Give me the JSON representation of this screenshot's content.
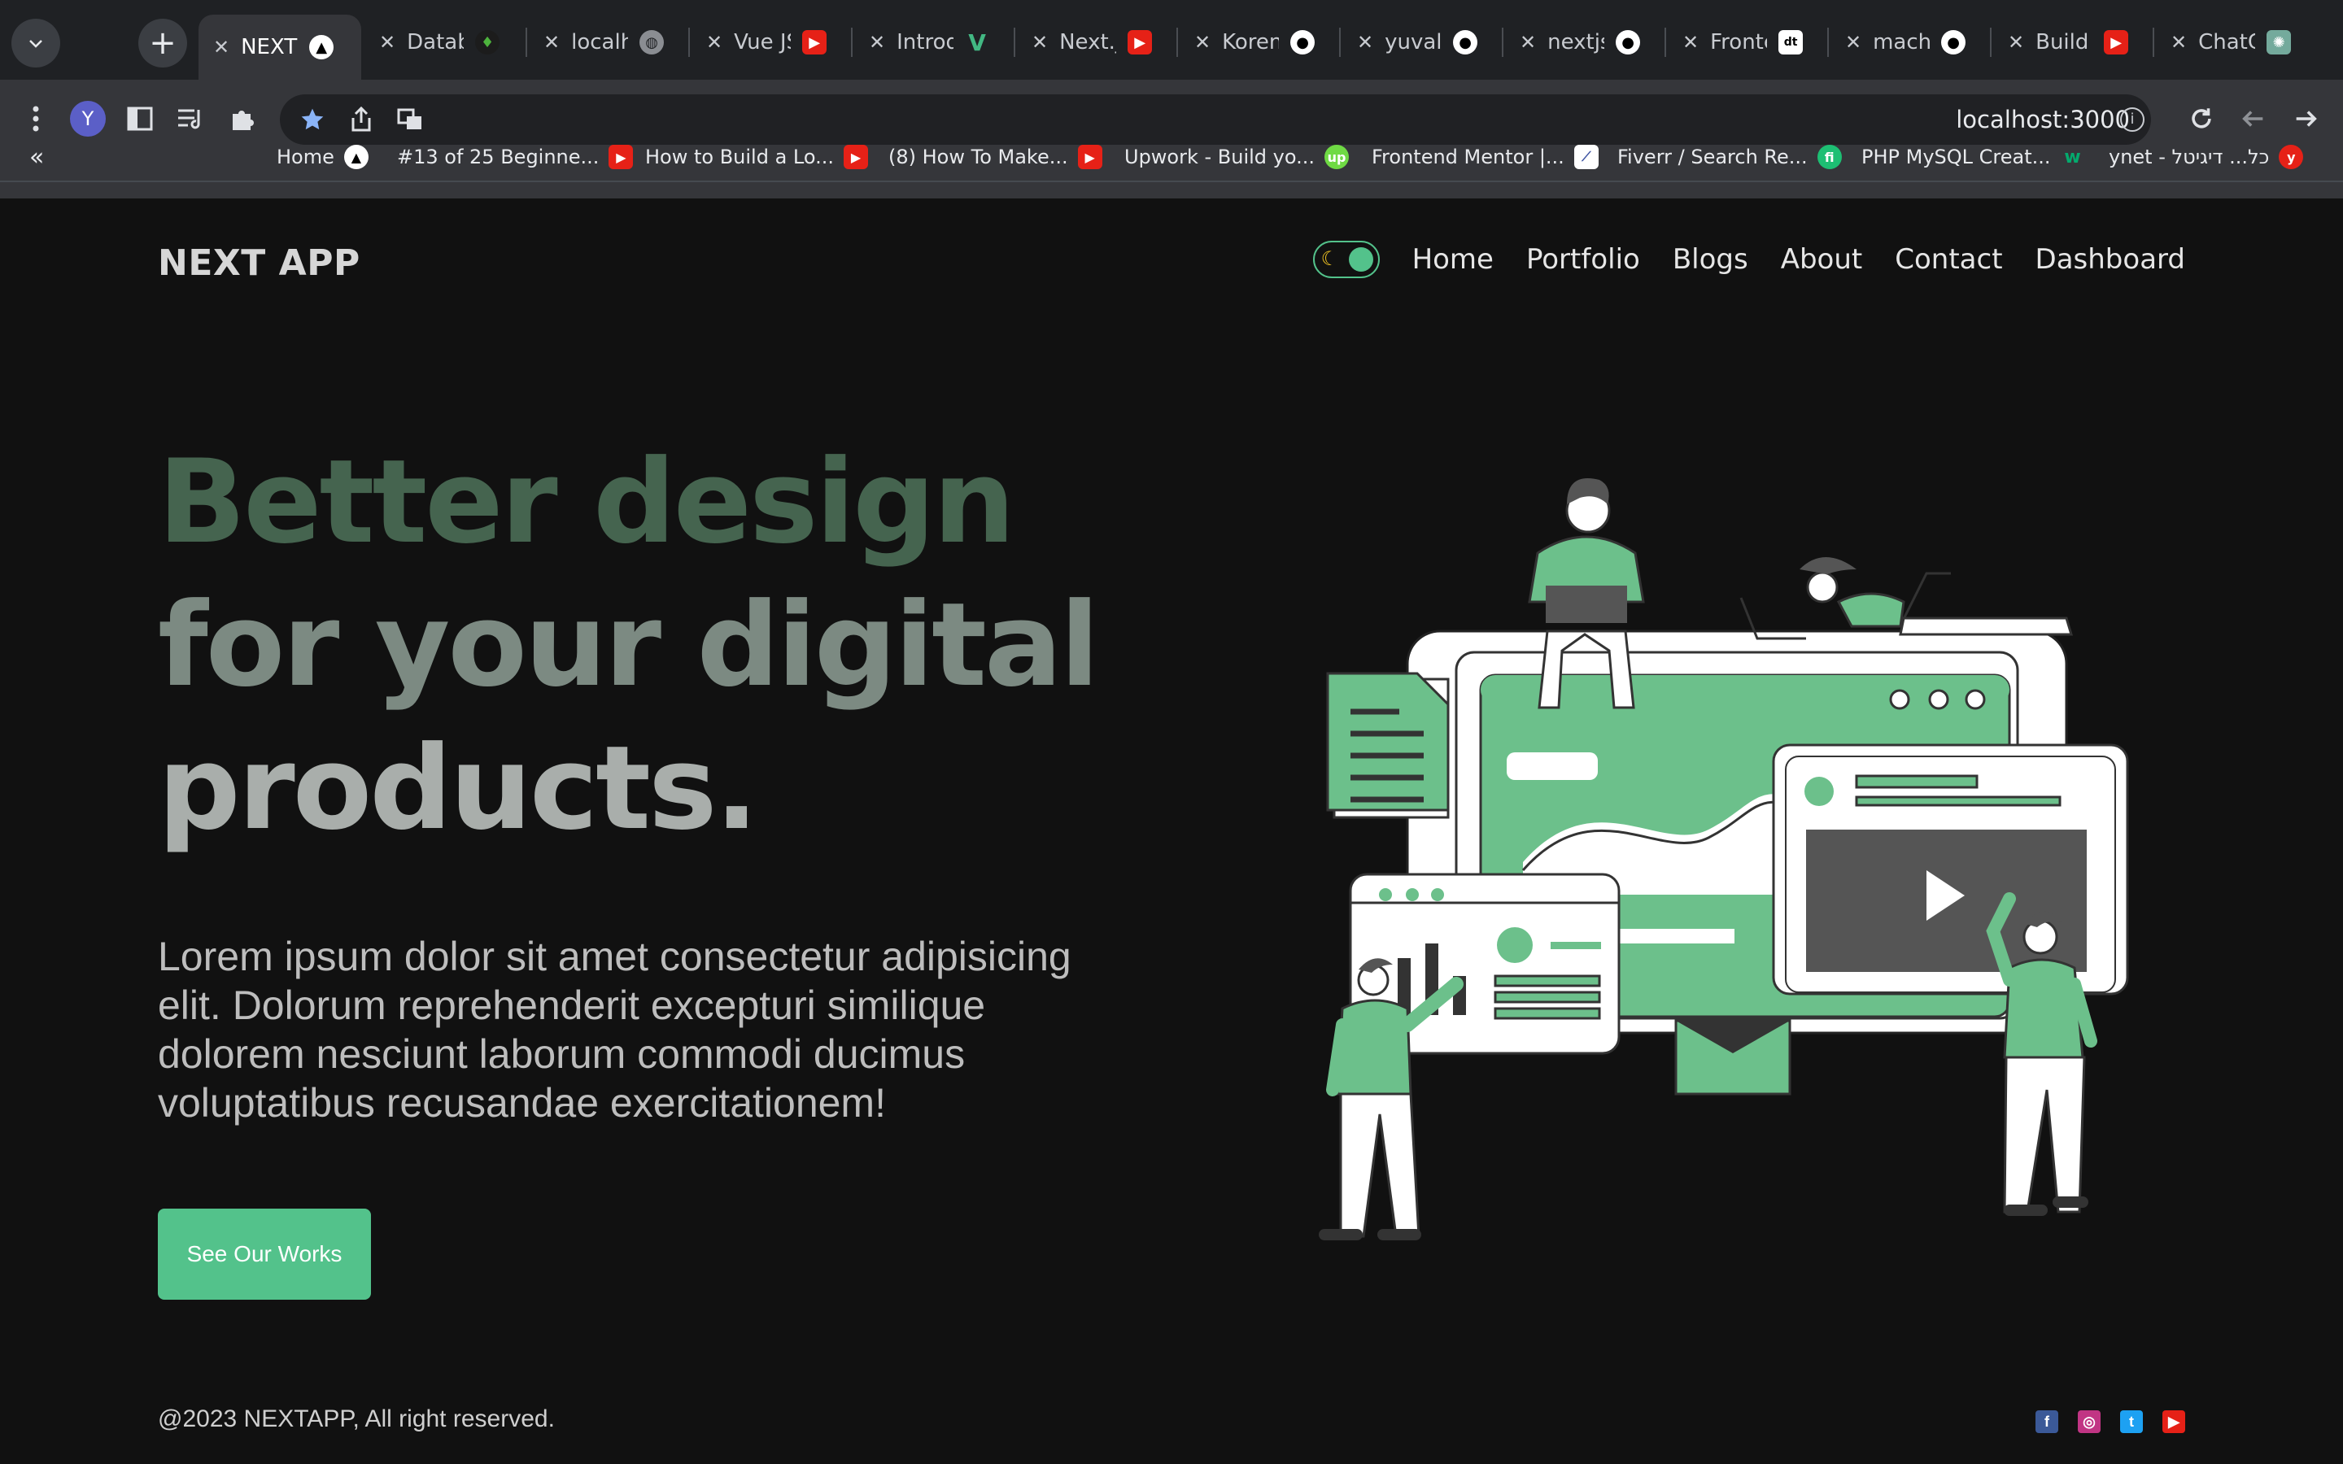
{
  "browser": {
    "tabs": [
      {
        "title": "NEXT APP",
        "active": true,
        "icon": "vercel-icon"
      },
      {
        "title": "Database",
        "icon": "mongodb-icon"
      },
      {
        "title": "localhost",
        "icon": "globe-icon"
      },
      {
        "title": "Vue JS",
        "icon": "youtube-icon"
      },
      {
        "title": "Introduction",
        "icon": "vue-icon"
      },
      {
        "title": "Next.js",
        "icon": "youtube-icon"
      },
      {
        "title": "KorenC",
        "icon": "github-icon"
      },
      {
        "title": "yuvalle",
        "icon": "github-icon"
      },
      {
        "title": "nextjs",
        "icon": "github-icon"
      },
      {
        "title": "Frontend",
        "icon": "devto-icon"
      },
      {
        "title": "macha",
        "icon": "github-icon"
      },
      {
        "title": "Build a",
        "icon": "youtube-icon"
      },
      {
        "title": "ChatGPT",
        "icon": "openai-icon"
      }
    ],
    "url": "localhost:3000",
    "profile_initial": "Y",
    "bookmarks": [
      {
        "label": "«"
      },
      {
        "label": "Home",
        "icon": "vercel-icon"
      },
      {
        "label": "#13 of 25 Beginne...",
        "icon": "youtube-icon"
      },
      {
        "label": "How to Build a Lo...",
        "icon": "youtube-icon"
      },
      {
        "label": "(8) How To Make...",
        "icon": "youtube-icon"
      },
      {
        "label": "Upwork - Build yo...",
        "icon": "upwork-icon"
      },
      {
        "label": "Frontend Mentor |...",
        "icon": "frontend-mentor-icon"
      },
      {
        "label": "Fiverr / Search Re...",
        "icon": "fiverr-icon"
      },
      {
        "label": "PHP MySQL Creat...",
        "icon": "w3-icon"
      },
      {
        "label": "ynet - כל... דיגיטל",
        "icon": "ynet-icon"
      }
    ]
  },
  "app": {
    "brand": "NEXT APP",
    "nav": [
      "Home",
      "Portfolio",
      "Blogs",
      "About",
      "Contact",
      "Dashboard"
    ],
    "hero": {
      "line1": "Better design",
      "line2": "for your digital",
      "line3": "products.",
      "description": "Lorem ipsum dolor sit amet consectetur adipisicing elit. Dolorum reprehenderit excepturi similique dolorem nesciunt laborum commodi ducimus voluptatibus recusandae exercitationem!",
      "cta": "See Our Works"
    },
    "footer": {
      "copyright": "@2023 NEXTAPP, All right reserved.",
      "social": [
        "facebook-icon",
        "instagram-icon",
        "twitter-icon",
        "youtube-icon"
      ]
    },
    "colors": {
      "accent": "#53c28b",
      "background": "#111111"
    }
  }
}
